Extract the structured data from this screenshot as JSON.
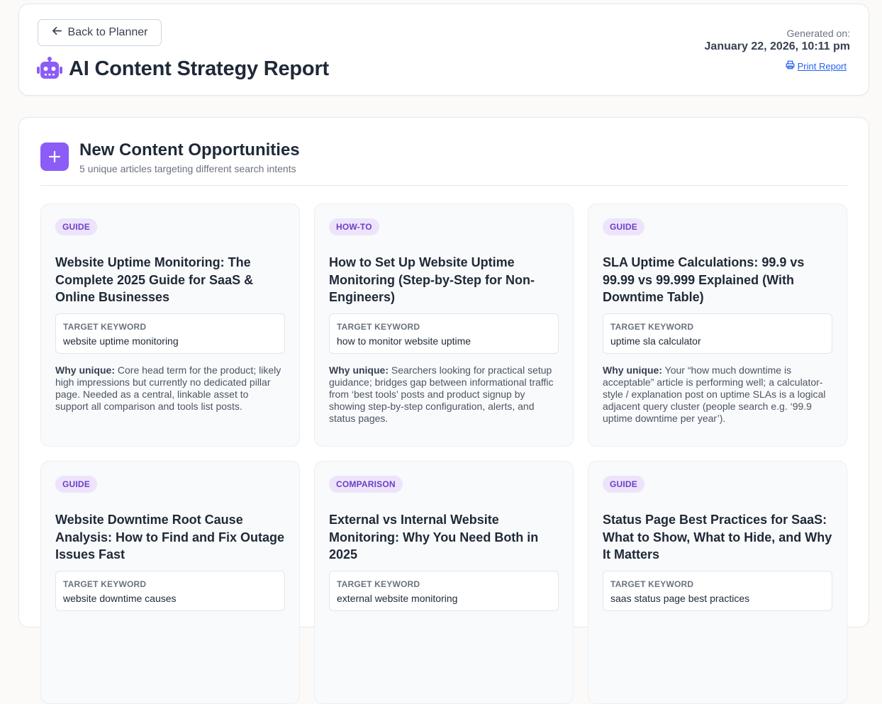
{
  "header": {
    "back_label": "Back to Planner",
    "title": "AI Content Strategy Report",
    "generated_label": "Generated on:",
    "generated_date": "January 22, 2026, 10:11 pm",
    "print_label": "Print Report"
  },
  "section": {
    "title": "New Content Opportunities",
    "subtitle": "5 unique articles targeting different search intents"
  },
  "labels": {
    "target_keyword": "TARGET KEYWORD",
    "why_unique": "Why unique:"
  },
  "cards": [
    {
      "badge": "GUIDE",
      "title": "Website Uptime Monitoring: The Complete 2025 Guide for SaaS & Online Businesses",
      "keyword": "website uptime monitoring",
      "why": "Core head term for the product; likely high impressions but currently no dedicated pillar page. Needed as a central, linkable asset to support all comparison and tools list posts."
    },
    {
      "badge": "HOW-TO",
      "title": "How to Set Up Website Uptime Monitoring (Step-by-Step for Non-Engineers)",
      "keyword": "how to monitor website uptime",
      "why": "Searchers looking for practical setup guidance; bridges gap between informational traffic from ‘best tools’ posts and product signup by showing step-by-step configuration, alerts, and status pages."
    },
    {
      "badge": "GUIDE",
      "title": "SLA Uptime Calculations: 99.9 vs 99.99 vs 99.999 Explained (With Downtime Table)",
      "keyword": "uptime sla calculator",
      "why": "Your “how much downtime is acceptable” article is performing well; a calculator-style / explanation post on uptime SLAs is a logical adjacent query cluster (people search e.g. ‘99.9 uptime downtime per year’)."
    },
    {
      "badge": "GUIDE",
      "title": "Website Downtime Root Cause Analysis: How to Find and Fix Outage Issues Fast",
      "keyword": "website downtime causes",
      "why": ""
    },
    {
      "badge": "COMPARISON",
      "title": "External vs Internal Website Monitoring: Why You Need Both in 2025",
      "keyword": "external website monitoring",
      "why": ""
    },
    {
      "badge": "GUIDE",
      "title": "Status Page Best Practices for SaaS: What to Show, What to Hide, and Why It Matters",
      "keyword": "saas status page best practices",
      "why": ""
    }
  ]
}
